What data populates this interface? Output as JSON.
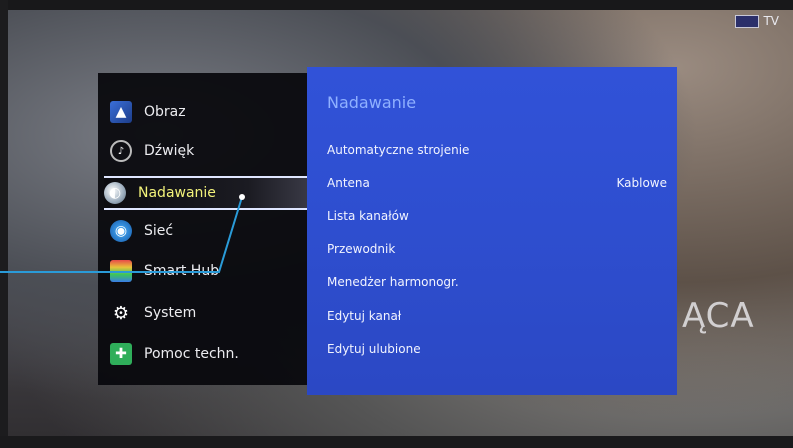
{
  "tv_badge": {
    "label": "TV"
  },
  "background_text": "ĄCA",
  "menu": {
    "items": [
      {
        "label": "Obraz",
        "icon": "picture-icon"
      },
      {
        "label": "Dźwięk",
        "icon": "sound-icon"
      },
      {
        "label": "Nadawanie",
        "icon": "broadcast-icon",
        "selected": true
      },
      {
        "label": "Sieć",
        "icon": "network-icon"
      },
      {
        "label": "Smart Hub",
        "icon": "smart-hub-icon"
      },
      {
        "label": "System",
        "icon": "gear-icon"
      },
      {
        "label": "Pomoc techn.",
        "icon": "support-icon"
      }
    ]
  },
  "panel": {
    "title": "Nadawanie",
    "options": [
      {
        "label": "Automatyczne strojenie",
        "value": ""
      },
      {
        "label": "Antena",
        "value": "Kablowe"
      },
      {
        "label": "Lista kanałów",
        "value": ""
      },
      {
        "label": "Przewodnik",
        "value": ""
      },
      {
        "label": "Menedżer harmonogr.",
        "value": ""
      },
      {
        "label": "Edytuj kanał",
        "value": ""
      },
      {
        "label": "Edytuj ulubione",
        "value": ""
      }
    ]
  },
  "colors": {
    "panel_blue": "#2e4ecf",
    "selected_text": "#f2f27a",
    "title_text": "#8fb0ff",
    "annotation_line": "#2a9bd8"
  }
}
